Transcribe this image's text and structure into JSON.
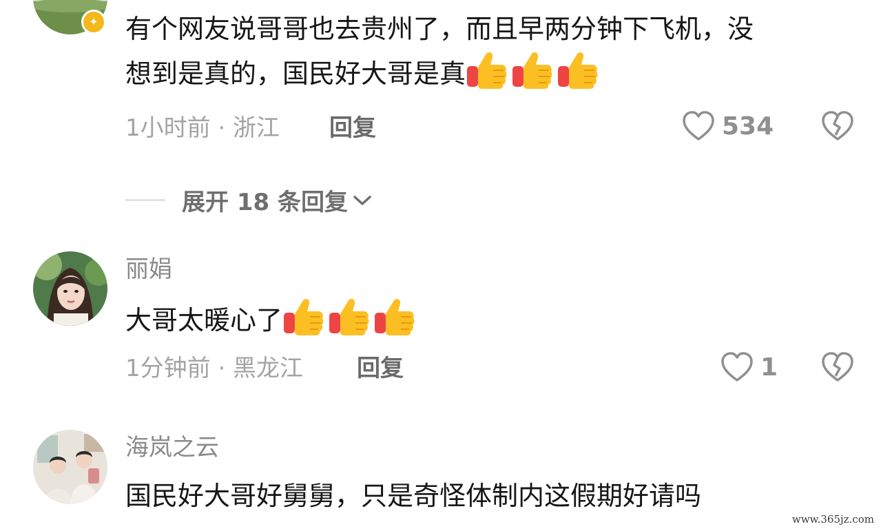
{
  "comments": [
    {
      "username": "",
      "content_line1": "有个网友说哥哥也去贵州了，而且早两分钟下飞机，没",
      "content_line2": "想到是真的，国民好大哥是真",
      "emoji_count": 3,
      "emoji_name": "thumbs-up-emoji",
      "meta": "1小时前 · 浙江",
      "reply_label": "回复",
      "likes": "534",
      "badge": "",
      "expand_label": "展开 18 条回复"
    },
    {
      "username": "丽娟",
      "content": "大哥太暖心了",
      "emoji_count": 3,
      "emoji_name": "thumbs-up-emoji",
      "meta": "1分钟前 · 黑龙江",
      "reply_label": "回复",
      "likes": "1"
    },
    {
      "username": "海岚之云",
      "content": "国民好大哥好舅舅，只是奇怪体制内这假期好请吗"
    }
  ],
  "icons": {
    "like": "heart-outline-icon",
    "dislike": "broken-heart-icon",
    "expand": "chevron-down-icon"
  },
  "colors": {
    "text": "#161616",
    "muted": "#a3a3a3",
    "username": "#8a8a8a",
    "icon": "#8f8f8f",
    "thumb_yellow": "#fbbf24",
    "thumb_red": "#ef4444"
  },
  "watermark": "www.365jz.com"
}
